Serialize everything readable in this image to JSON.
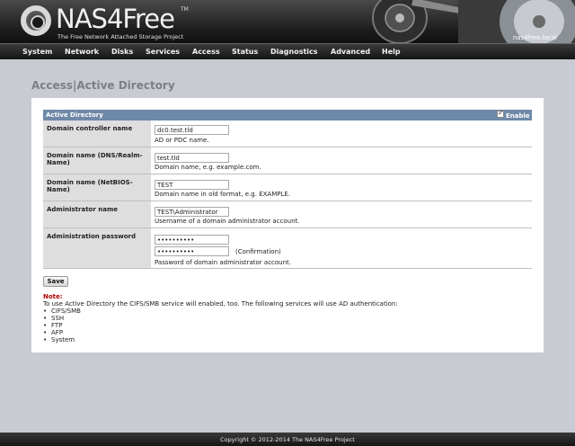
{
  "header": {
    "logo": "NAS4Free",
    "tagline": "The Free Network Attached Storage Project",
    "hostname": "nas4free.local"
  },
  "nav": [
    "System",
    "Network",
    "Disks",
    "Services",
    "Access",
    "Status",
    "Diagnostics",
    "Advanced",
    "Help"
  ],
  "page_title": "Access|Active Directory",
  "section": {
    "title": "Active Directory",
    "enable_label": "Enable",
    "enable_checked": true
  },
  "fields": [
    {
      "label": "Domain controller name",
      "value": "dc0.test.tld",
      "hint": "AD or PDC name."
    },
    {
      "label": "Domain name (DNS/Realm-Name)",
      "value": "test.tld",
      "hint": "Domain name, e.g. example.com."
    },
    {
      "label": "Domain name (NetBIOS-Name)",
      "value": "TEST",
      "hint": "Domain name in old format, e.g. EXAMPLE."
    },
    {
      "label": "Administrator name",
      "value": "TEST\\Administrator",
      "hint": "Username of a domain administrator account."
    },
    {
      "label": "Administration password",
      "value": "••••••••••",
      "confirm_value": "••••••••••",
      "confirm_label": "(Confirmation)",
      "hint": "Password of domain administrator account."
    }
  ],
  "save_label": "Save",
  "note": {
    "heading": "Note:",
    "text": "To use Active Directory the CIFS/SMB service will enabled, too. The following services will use AD authentication:",
    "services": [
      "CIFS/SMB",
      "SSH",
      "FTP",
      "AFP",
      "System"
    ]
  },
  "footer": "Copyright © 2012-2014 The NAS4Free Project",
  "colors": {
    "section_header": "#6f89a8",
    "note_heading": "#b00000",
    "page_bg": "#c8ccd2"
  }
}
